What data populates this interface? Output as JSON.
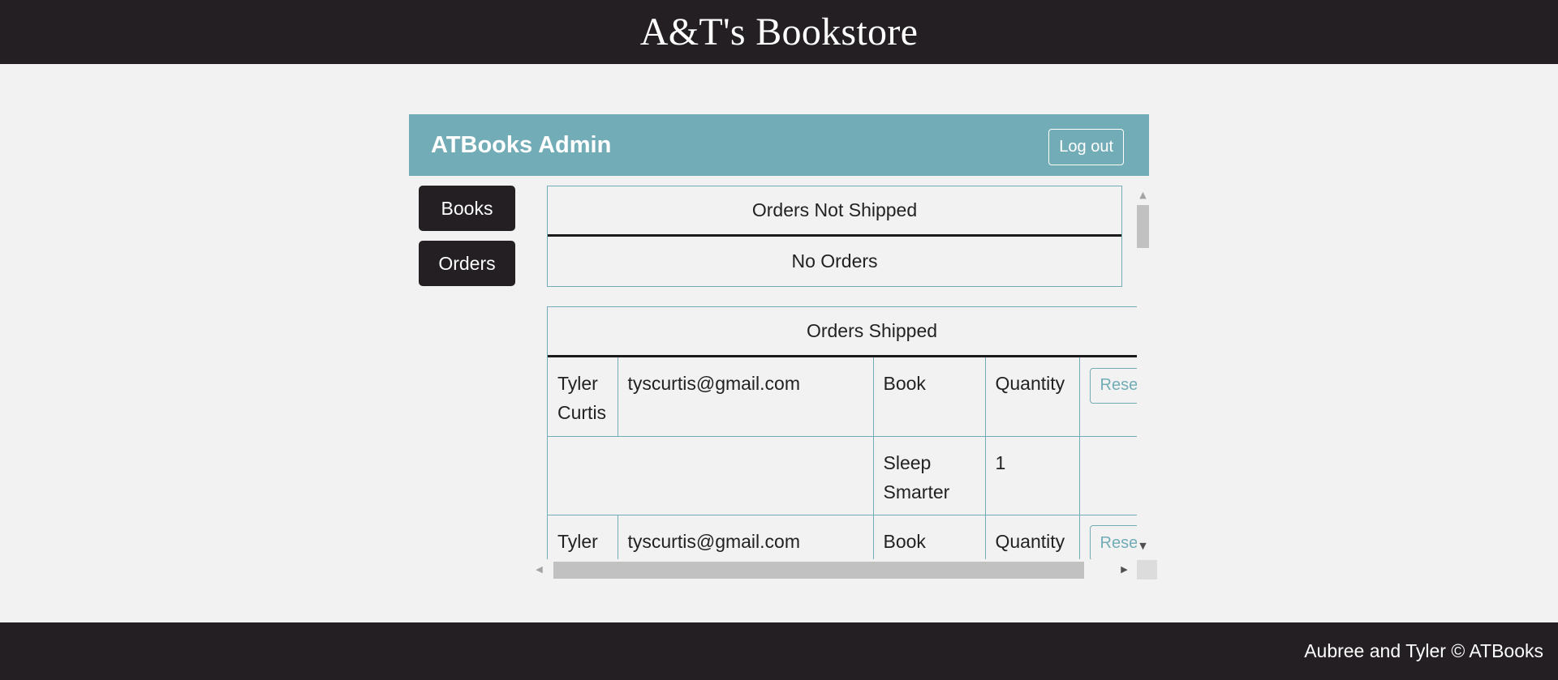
{
  "site": {
    "title": "A&T's Bookstore",
    "footer": "Aubree and Tyler © ATBooks"
  },
  "admin": {
    "title": "ATBooks Admin",
    "logout_label": "Log out"
  },
  "nav": {
    "books_label": "Books",
    "orders_label": "Orders"
  },
  "unshipped": {
    "header": "Orders Not Shipped",
    "empty_text": "No Orders"
  },
  "shipped": {
    "header": "Orders Shipped",
    "orders": [
      {
        "name": "Tyler Curtis",
        "email": "tyscurtis@gmail.com",
        "book_header": "Book",
        "quantity_header": "Quantity",
        "action_label": "Reset",
        "items": [
          {
            "book": "Sleep Smarter",
            "quantity": "1"
          }
        ]
      },
      {
        "name": "Tyler",
        "email": "tyscurtis@gmail.com",
        "book_header": "Book",
        "quantity_header": "Quantity",
        "action_label": "Reset"
      }
    ]
  },
  "icons": {
    "scroll_up": "triangle-up-icon",
    "scroll_down": "triangle-down-icon",
    "scroll_left": "triangle-left-icon",
    "scroll_right": "triangle-right-icon"
  },
  "colors": {
    "header_bg": "#231f22",
    "accent": "#72acb6",
    "page_bg": "#f2f2f2"
  }
}
